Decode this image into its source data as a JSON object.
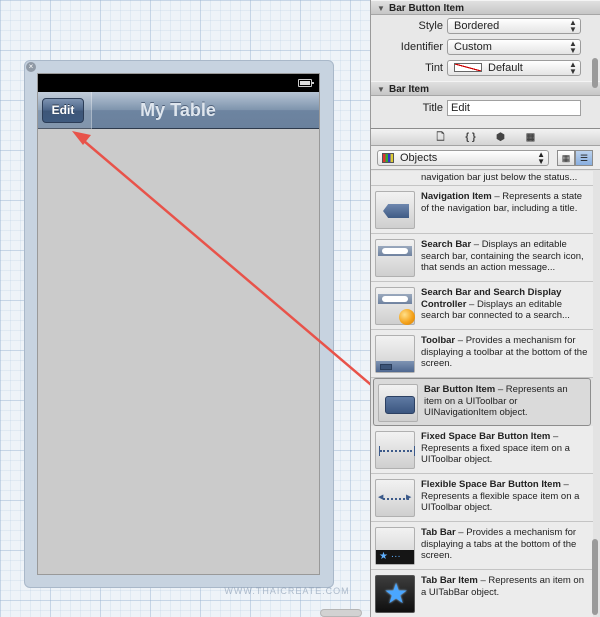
{
  "canvas": {
    "nav_title": "My Table",
    "edit_button_label": "Edit",
    "close_glyph": "×"
  },
  "inspector": {
    "bar_button_item_header": "Bar Button Item",
    "style_label": "Style",
    "style_value": "Bordered",
    "identifier_label": "Identifier",
    "identifier_value": "Custom",
    "tint_label": "Tint",
    "tint_value": "Default",
    "bar_item_header": "Bar Item",
    "title_label": "Title",
    "title_value": "Edit"
  },
  "library": {
    "tabs": [
      "🗋",
      "{ }",
      "⬢",
      "▦"
    ],
    "filter_value": "Objects",
    "items": [
      {
        "name": "",
        "desc": "navigation bar just below the status..."
      },
      {
        "name": "Navigation Item",
        "desc": " – Represents a state of the navigation bar, including a title."
      },
      {
        "name": "Search Bar",
        "desc": " – Displays an editable search bar, containing the search icon, that sends an action message..."
      },
      {
        "name": "Search Bar and Search Display Controller",
        "desc": " – Displays an editable search bar connected to a search..."
      },
      {
        "name": "Toolbar",
        "desc": " – Provides a mechanism for displaying a toolbar at the bottom of the screen."
      },
      {
        "name": "Bar Button Item",
        "desc": " – Represents an item on a UIToolbar or UINavigationItem object."
      },
      {
        "name": "Fixed Space Bar Button Item",
        "desc": " – Represents a fixed space item on a UIToolbar object."
      },
      {
        "name": "Flexible Space Bar Button Item",
        "desc": " – Represents a flexible space item on a UIToolbar object."
      },
      {
        "name": "Tab Bar",
        "desc": " – Provides a mechanism for displaying a tabs at the bottom of the screen."
      },
      {
        "name": "Tab Bar Item",
        "desc": " – Represents an item on a UITabBar object."
      }
    ]
  },
  "watermark": "WWW.THAICREATE.COM",
  "colors": {
    "arrow": "#e8534a",
    "nav_bar": "#6d84a0",
    "selection": "#dadada"
  }
}
